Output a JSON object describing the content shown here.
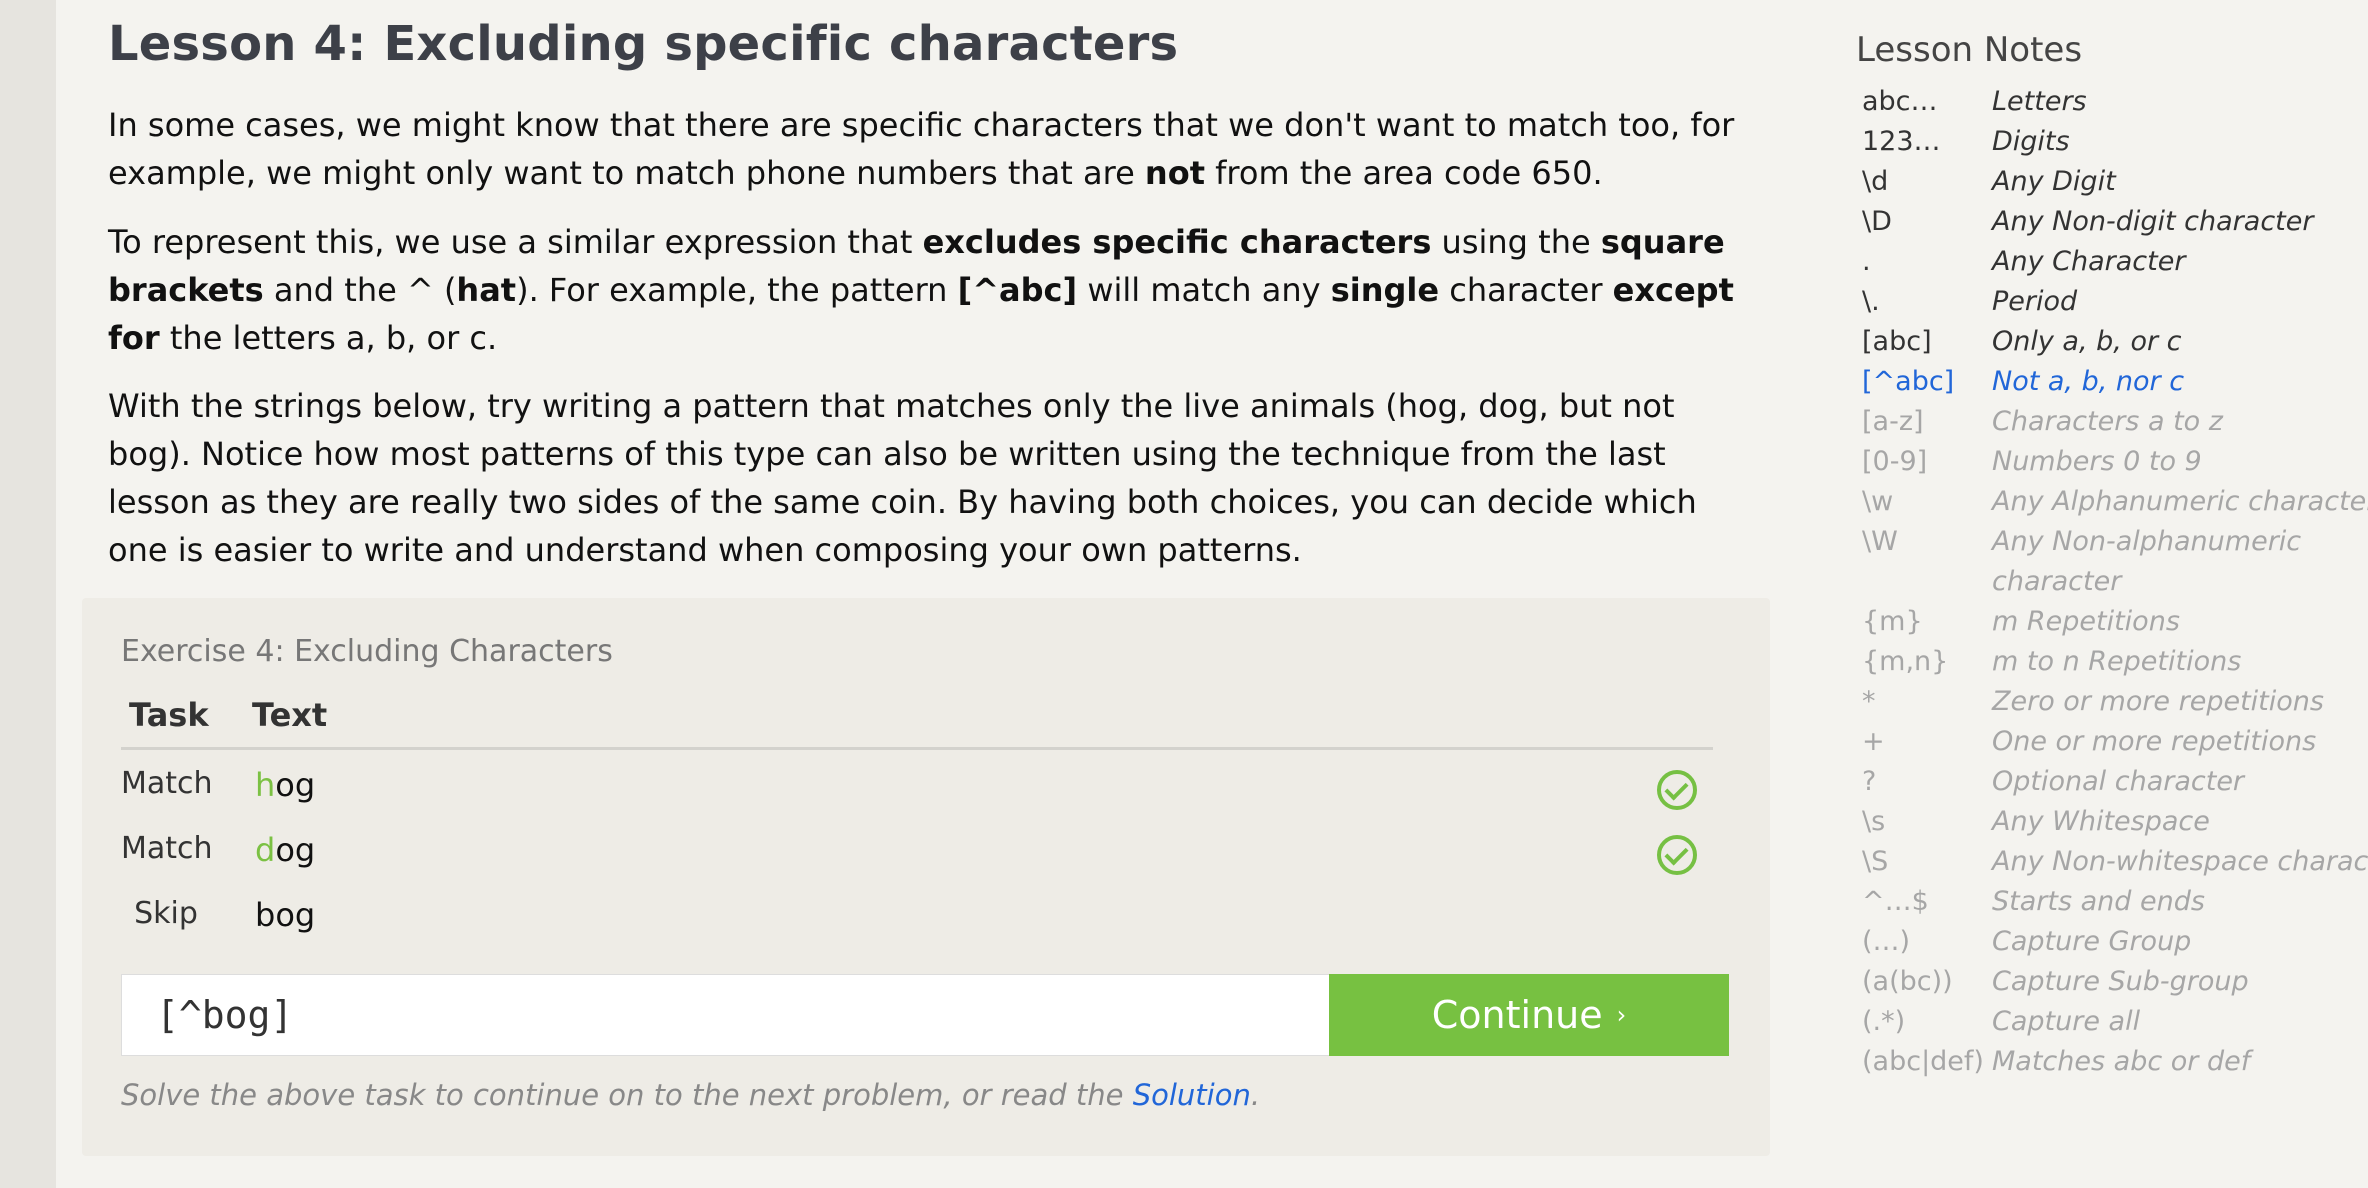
{
  "lesson": {
    "title": "Lesson 4: Excluding specific characters",
    "p1": [
      {
        "t": "In some cases, we might know that there are specific characters that we don't want to match too, for example, we might only want to match phone numbers that are "
      },
      {
        "t": "not",
        "b": true
      },
      {
        "t": " from the area code 650."
      }
    ],
    "p2": [
      {
        "t": "To represent this, we use a similar expression that "
      },
      {
        "t": "excludes specific characters",
        "b": true
      },
      {
        "t": " using the "
      },
      {
        "t": "square brackets",
        "b": true
      },
      {
        "t": " and the ^ ("
      },
      {
        "t": "hat",
        "b": true
      },
      {
        "t": "). For example, the pattern "
      },
      {
        "t": "[^abc]",
        "b": true
      },
      {
        "t": " will match any "
      },
      {
        "t": "single",
        "b": true
      },
      {
        "t": " character "
      },
      {
        "t": "except for",
        "b": true
      },
      {
        "t": " the letters a, b, or c."
      }
    ],
    "p3": [
      {
        "t": "With the strings below, try writing a pattern that matches only the live animals (hog, dog, but not bog). Notice how most patterns of this type can also be written using the technique from the last lesson as they are really two sides of the same coin. By having both choices, you can decide which one is easier to write and understand when composing your own patterns."
      }
    ]
  },
  "exercise": {
    "title": "Exercise 4: Excluding Characters",
    "col_task": "Task",
    "col_text": "Text",
    "rows": [
      {
        "task": "Match",
        "highlight": "h",
        "rest": "og",
        "passed": true
      },
      {
        "task": "Match",
        "highlight": "d",
        "rest": "og",
        "passed": true
      },
      {
        "task": "Skip",
        "highlight": "",
        "rest": "bog",
        "passed": false
      }
    ],
    "input_value": "[^bog]",
    "continue_label": "Continue",
    "continue_chevron": "›",
    "hint_prefix": "Solve the above task to continue on to the next problem, or read the ",
    "hint_link": "Solution",
    "hint_suffix": "."
  },
  "notes": {
    "title": "Lesson Notes",
    "items": [
      {
        "key": "abc…",
        "val": "Letters",
        "state": "dark"
      },
      {
        "key": "123…",
        "val": "Digits",
        "state": "dark"
      },
      {
        "key": "\\d",
        "val": "Any Digit",
        "state": "dark"
      },
      {
        "key": "\\D",
        "val": "Any Non-digit character",
        "state": "dark"
      },
      {
        "key": ".",
        "val": "Any Character",
        "state": "dark"
      },
      {
        "key": "\\.",
        "val": "Period",
        "state": "dark"
      },
      {
        "key": "[abc]",
        "val": "Only a, b, or c",
        "state": "dark"
      },
      {
        "key": "[^abc]",
        "val": "Not a, b, nor c",
        "state": "active"
      },
      {
        "key": "[a-z]",
        "val": "Characters a to z",
        "state": "dim"
      },
      {
        "key": "[0-9]",
        "val": "Numbers 0 to 9",
        "state": "dim"
      },
      {
        "key": "\\w",
        "val": "Any Alphanumeric character",
        "state": "dim"
      },
      {
        "key": "\\W",
        "val": "Any Non-alphanumeric",
        "state": "dim"
      },
      {
        "key": "",
        "val": "character",
        "state": "dim"
      },
      {
        "key": "{m}",
        "val": "m Repetitions",
        "state": "dim"
      },
      {
        "key": "{m,n}",
        "val": "m to n Repetitions",
        "state": "dim"
      },
      {
        "key": "*",
        "val": "Zero or more repetitions",
        "state": "dim"
      },
      {
        "key": "+",
        "val": "One or more repetitions",
        "state": "dim"
      },
      {
        "key": "?",
        "val": "Optional character",
        "state": "dim"
      },
      {
        "key": "\\s",
        "val": "Any Whitespace",
        "state": "dim"
      },
      {
        "key": "\\S",
        "val": "Any Non-whitespace characte",
        "state": "dim"
      },
      {
        "key": "^…$",
        "val": "Starts and ends",
        "state": "dim"
      },
      {
        "key": "(…)",
        "val": "Capture Group",
        "state": "dim"
      },
      {
        "key": "(a(bc))",
        "val": "Capture Sub-group",
        "state": "dim"
      },
      {
        "key": "(.*)",
        "val": "Capture all",
        "state": "dim"
      },
      {
        "key": "(abc|def)",
        "val": "Matches abc or def",
        "state": "dim"
      }
    ]
  },
  "colors": {
    "accent_green": "#77c141",
    "link_blue": "#2166d8"
  }
}
